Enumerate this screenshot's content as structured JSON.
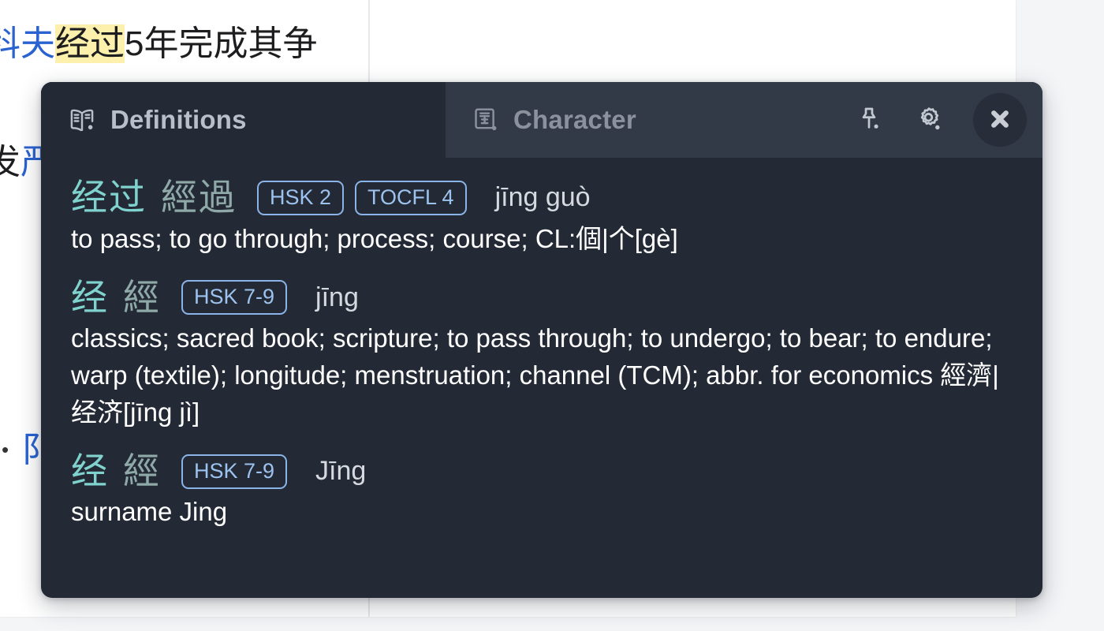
{
  "background_page": {
    "line1": {
      "prefix_partial": "科夫",
      "highlighted": "经过",
      "suffix": "5年完成其争"
    },
    "line2": {
      "text": "发",
      "link": "严"
    },
    "line3": {
      "bullet": "•",
      "link": "阝"
    }
  },
  "popup": {
    "tabs": [
      {
        "id": "definitions",
        "label": "Definitions",
        "icon": "book-icon",
        "active": true
      },
      {
        "id": "character",
        "label": "Character",
        "icon": "character-card-icon",
        "active": false
      }
    ],
    "actions": [
      {
        "id": "pin",
        "icon": "pin-icon",
        "label": "Pin"
      },
      {
        "id": "settings",
        "icon": "gear-icon",
        "label": "Settings"
      },
      {
        "id": "close",
        "icon": "close-icon",
        "label": "Close"
      }
    ],
    "entries": [
      {
        "simplified": "经过",
        "traditional": "經過",
        "badges": [
          "HSK 2",
          "TOCFL 4"
        ],
        "pinyin": "jīng guò",
        "definition": "to pass; to go through; process; course; CL:個|个[gè]"
      },
      {
        "simplified": "经",
        "traditional": "經",
        "badges": [
          "HSK 7-9"
        ],
        "pinyin": "jīng",
        "definition": "classics; sacred book; scripture; to pass through; to undergo; to bear; to endure; warp (textile); longitude; menstruation; channel (TCM); abbr. for economics 經濟|经济[jīng jì]"
      },
      {
        "simplified": "经",
        "traditional": "經",
        "badges": [
          "HSK 7-9"
        ],
        "pinyin": "Jīng",
        "definition": "surname Jing"
      }
    ]
  },
  "colors": {
    "popup_bg": "#242a35",
    "header_bg": "#333a47",
    "active_tab_bg": "#242a35",
    "simplified": "#7fd2cd",
    "traditional": "#8ea9a8",
    "badge_border": "#8ab4e8",
    "badge_text": "#9cc3ef",
    "pinyin": "#d6dae0",
    "definition": "#ffffff",
    "highlight": "#fdf0ad",
    "link": "#2a62d0"
  }
}
